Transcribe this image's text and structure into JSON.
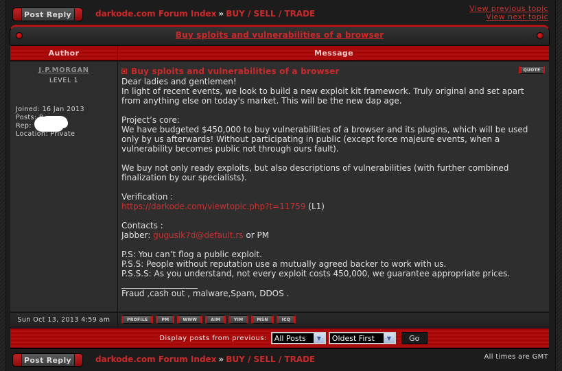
{
  "top_nav": {
    "post_reply_label": "Post Reply",
    "breadcrumb": {
      "forum_index": "darkode.com Forum Index",
      "separator": "»",
      "section": "BUY / SELL / TRADE"
    },
    "view_previous_topic": "View previous topic",
    "view_next_topic": "View next topic"
  },
  "topic": {
    "title": "Buy sploits and vulnerabilities of a browser",
    "columns": {
      "author": "Author",
      "message": "Message"
    }
  },
  "post": {
    "author": {
      "username": "J.P.MORGAN",
      "rank": "LEVEL 1",
      "joined": "Joined: 16 Jan 2013",
      "posts": "Posts: 8",
      "rep": "Rep: ",
      "location": "Location: Private"
    },
    "subject": "Buy sploits and vulnerabilities of a browser",
    "quote_label": "QUOTE",
    "body": {
      "greeting": "Dear ladies and gentlemen!",
      "intro": "In light of recent events, we look to build a new exploit kit framework. Truly original and set apart from anything else on today's market. This will be the new dap age.",
      "core_heading": "Project’s core:",
      "core_text": "We have budgeted $450,000 to buy vulnerabilities of a browser and its plugins, which will be used only by us afterwards! Without participating in public (except force majeure events, when a vulnerability becomes public not through ours fault).",
      "buy_text": "We buy not only ready exploits, but also descriptions of vulnerabilities (with further combined finalization by our specialists).",
      "verification_heading": "Verification :",
      "verification_link": "https://darkode.com/viewtopic.php?t=11759",
      "verification_suffix": " (L1)",
      "contacts_heading": "Contacts :",
      "jabber_prefix": "Jabber: ",
      "jabber_link": "gugusik7d@default.rs",
      "jabber_suffix": " or PM",
      "ps1": "P.S: You can’t flog a public exploit.",
      "ps2": "P.S.S: People without reputation use a mutually agreed backer to work with us.",
      "ps3": "P.S.S.S: As you understand, not every exploit costs 450,000, we guarantee appropriate prices.",
      "signature": "Fraud ,cash out , malware,Spam, DDOS ."
    },
    "date": "Sun Oct 13, 2013 4:59 am",
    "contact_buttons": [
      "PROFILE",
      "PM",
      "WWW",
      "AIM",
      "YIM",
      "MSN",
      "ICQ"
    ]
  },
  "display_options": {
    "label": "Display posts from previous:",
    "posts_select": "All Posts",
    "order_select": "Oldest First",
    "go_label": "Go"
  },
  "bottom_nav": {
    "post_reply_label": "Post Reply",
    "breadcrumb": {
      "forum_index": "darkode.com Forum Index",
      "separator": "»",
      "section": "BUY / SELL / TRADE"
    },
    "timezone_note": "All times are GMT"
  }
}
